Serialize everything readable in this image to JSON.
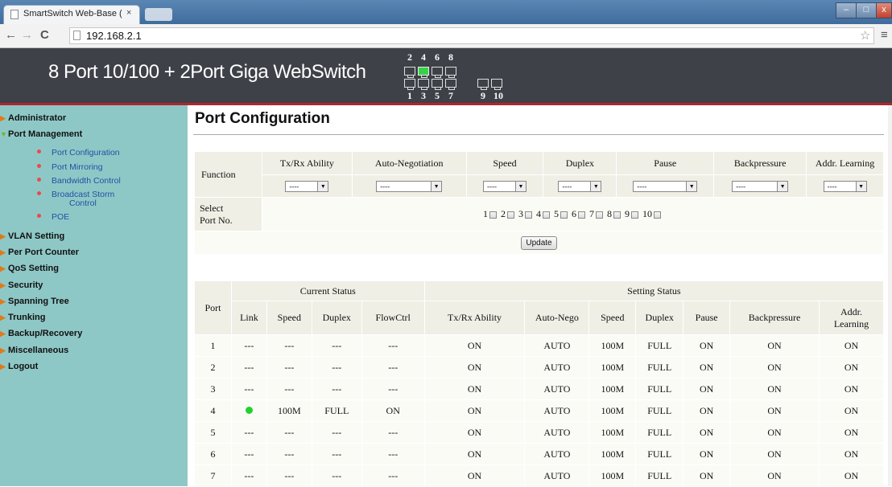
{
  "browser": {
    "tab_title": "SmartSwitch Web-Base (",
    "tab_close": "×",
    "url": "192.168.2.1",
    "back": "←",
    "forward": "→",
    "reload": "C",
    "star": "☆",
    "menu": "≡",
    "win_min": "–",
    "win_max": "□",
    "win_close": "x"
  },
  "header": {
    "product": "8 Port 10/100 + 2Port Giga WebSwitch",
    "ports_top": [
      "2",
      "4",
      "6",
      "8"
    ],
    "ports_bottom": [
      "1",
      "3",
      "5",
      "7",
      "9",
      "10"
    ],
    "port_up": "4",
    "up_color": "#36d24a"
  },
  "sidebar": {
    "items": [
      {
        "label": "Administrator"
      },
      {
        "label": "Port Management"
      },
      {
        "label": "VLAN Setting"
      },
      {
        "label": "Per Port Counter"
      },
      {
        "label": "QoS Setting"
      },
      {
        "label": "Security"
      },
      {
        "label": "Spanning Tree"
      },
      {
        "label": "Trunking"
      },
      {
        "label": "Backup/Recovery"
      },
      {
        "label": "Miscellaneous"
      },
      {
        "label": "Logout"
      }
    ],
    "sub_items": [
      {
        "label": "Port Configuration"
      },
      {
        "label": "Port Mirroring"
      },
      {
        "label": "Bandwidth Control"
      },
      {
        "label": "Broadcast Storm"
      },
      {
        "label": "Control"
      },
      {
        "label": "POE"
      }
    ]
  },
  "main": {
    "title": "Port Configuration",
    "config": {
      "function_label": "Function",
      "columns": [
        "Tx/Rx Ability",
        "Auto-Negotiation",
        "Speed",
        "Duplex",
        "Pause",
        "Backpressure",
        "Addr. Learning"
      ],
      "dropdown_value": "----",
      "select_label_1": "Select",
      "select_label_2": "Port No.",
      "ports": [
        "1",
        "2",
        "3",
        "4",
        "5",
        "6",
        "7",
        "8",
        "9",
        "10"
      ],
      "update_button": "Update"
    },
    "status": {
      "port_header": "Port",
      "current_group": "Current Status",
      "setting_group": "Setting Status",
      "current_cols": [
        "Link",
        "Speed",
        "Duplex",
        "FlowCtrl"
      ],
      "setting_cols": [
        "Tx/Rx Ability",
        "Auto-Nego",
        "Speed",
        "Duplex",
        "Pause",
        "Backpressure"
      ],
      "last_col_1": "Addr.",
      "last_col_2": "Learning",
      "rows": [
        {
          "port": "1",
          "link": "---",
          "speed": "---",
          "duplex": "---",
          "flow": "---",
          "txrx": "ON",
          "nego": "AUTO",
          "s_speed": "100M",
          "s_duplex": "FULL",
          "pause": "ON",
          "bp": "ON",
          "learn": "ON"
        },
        {
          "port": "2",
          "link": "---",
          "speed": "---",
          "duplex": "---",
          "flow": "---",
          "txrx": "ON",
          "nego": "AUTO",
          "s_speed": "100M",
          "s_duplex": "FULL",
          "pause": "ON",
          "bp": "ON",
          "learn": "ON"
        },
        {
          "port": "3",
          "link": "---",
          "speed": "---",
          "duplex": "---",
          "flow": "---",
          "txrx": "ON",
          "nego": "AUTO",
          "s_speed": "100M",
          "s_duplex": "FULL",
          "pause": "ON",
          "bp": "ON",
          "learn": "ON"
        },
        {
          "port": "4",
          "link": "",
          "speed": "100M",
          "duplex": "FULL",
          "flow": "ON",
          "txrx": "ON",
          "nego": "AUTO",
          "s_speed": "100M",
          "s_duplex": "FULL",
          "pause": "ON",
          "bp": "ON",
          "learn": "ON"
        },
        {
          "port": "5",
          "link": "---",
          "speed": "---",
          "duplex": "---",
          "flow": "---",
          "txrx": "ON",
          "nego": "AUTO",
          "s_speed": "100M",
          "s_duplex": "FULL",
          "pause": "ON",
          "bp": "ON",
          "learn": "ON"
        },
        {
          "port": "6",
          "link": "---",
          "speed": "---",
          "duplex": "---",
          "flow": "---",
          "txrx": "ON",
          "nego": "AUTO",
          "s_speed": "100M",
          "s_duplex": "FULL",
          "pause": "ON",
          "bp": "ON",
          "learn": "ON"
        },
        {
          "port": "7",
          "link": "---",
          "speed": "---",
          "duplex": "---",
          "flow": "---",
          "txrx": "ON",
          "nego": "AUTO",
          "s_speed": "100M",
          "s_duplex": "FULL",
          "pause": "ON",
          "bp": "ON",
          "learn": "ON"
        }
      ]
    }
  }
}
